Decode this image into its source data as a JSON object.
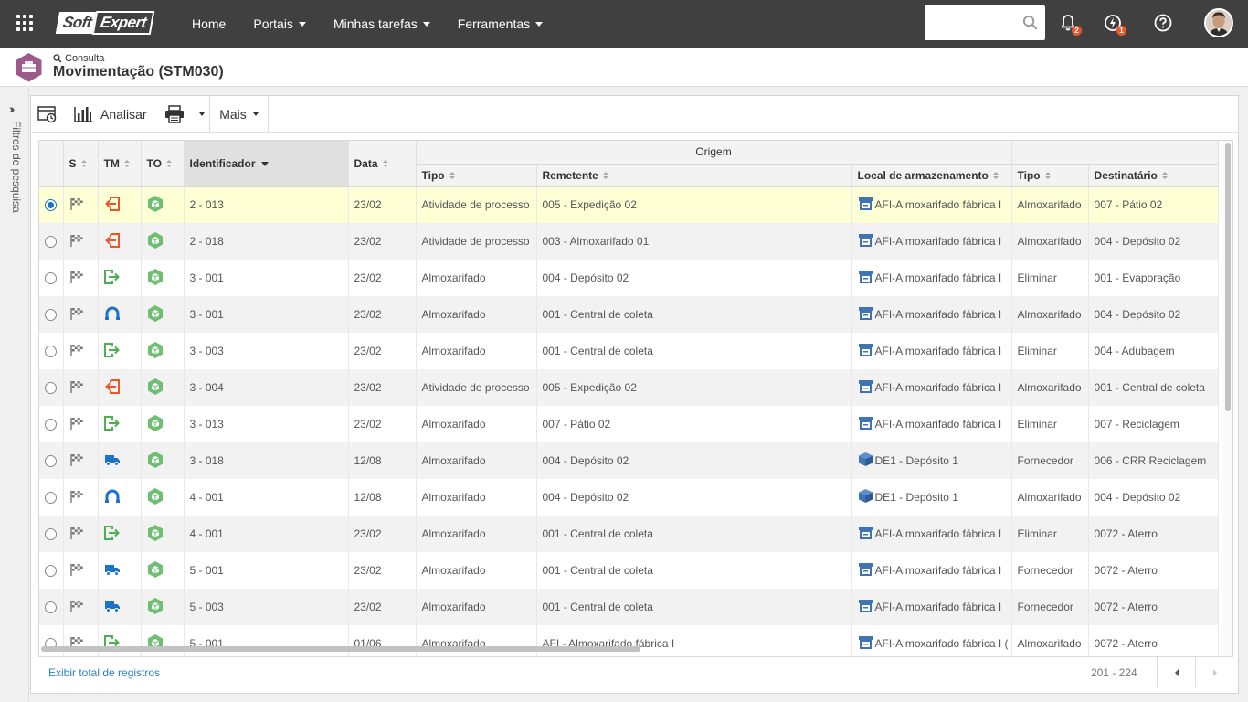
{
  "topbar": {
    "logo_soft": "Soft",
    "logo_expert": "Expert",
    "nav": [
      {
        "label": "Home",
        "caret": false
      },
      {
        "label": "Portais",
        "caret": true
      },
      {
        "label": "Minhas tarefas",
        "caret": true
      },
      {
        "label": "Ferramentas",
        "caret": true
      }
    ],
    "search_placeholder": "",
    "notifications_count": "2",
    "tasks_count": "1"
  },
  "header": {
    "breadcrumb": "Consulta",
    "title": "Movimentação (STM030)"
  },
  "filter_strip": {
    "label": "Filtros de pesquisa"
  },
  "toolbar": {
    "analyze_label": "Analisar",
    "more_label": "Mais"
  },
  "grid": {
    "group_header": "Origem",
    "columns": {
      "s": "S",
      "tm": "TM",
      "to": "TO",
      "id": "Identificador",
      "date": "Data",
      "orig_type": "Tipo",
      "sender": "Remetente",
      "storage": "Local de armazenamento",
      "dest_type": "Tipo",
      "recipient": "Destinatário"
    },
    "rows": [
      {
        "selected": true,
        "tm": "in-red",
        "id": "2 - 013",
        "date": "23/02",
        "orig_type": "Atividade de processo",
        "sender": "005 - Expedição 02",
        "storage_icon": "archive",
        "storage": "AFI-Almoxarifado fábrica I",
        "dest_type": "Almoxarifado",
        "recipient": "007 - Pátio 02"
      },
      {
        "selected": false,
        "tm": "in-red",
        "id": "2 - 018",
        "date": "23/02",
        "orig_type": "Atividade de processo",
        "sender": "003 - Almoxarifado 01",
        "storage_icon": "archive",
        "storage": "AFI-Almoxarifado fábrica I",
        "dest_type": "Almoxarifado",
        "recipient": "004 - Depósito 02"
      },
      {
        "selected": false,
        "tm": "out-green",
        "id": "3 - 001",
        "date": "23/02",
        "orig_type": "Almoxarifado",
        "sender": "004 - Depósito 02",
        "storage_icon": "archive",
        "storage": "AFI-Almoxarifado fábrica I",
        "dest_type": "Eliminar",
        "recipient": "001 - Evaporação"
      },
      {
        "selected": false,
        "tm": "magnet",
        "id": "3 - 001",
        "date": "23/02",
        "orig_type": "Almoxarifado",
        "sender": "001 - Central de coleta",
        "storage_icon": "archive",
        "storage": "AFI-Almoxarifado fábrica I",
        "dest_type": "Almoxarifado",
        "recipient": "004 - Depósito 02"
      },
      {
        "selected": false,
        "tm": "out-green",
        "id": "3 - 003",
        "date": "23/02",
        "orig_type": "Almoxarifado",
        "sender": "001 - Central de coleta",
        "storage_icon": "archive",
        "storage": "AFI-Almoxarifado fábrica I",
        "dest_type": "Eliminar",
        "recipient": "004 - Adubagem"
      },
      {
        "selected": false,
        "tm": "in-red",
        "id": "3 - 004",
        "date": "23/02",
        "orig_type": "Atividade de processo",
        "sender": "005 - Expedição 02",
        "storage_icon": "archive",
        "storage": "AFI-Almoxarifado fábrica I",
        "dest_type": "Almoxarifado",
        "recipient": "001 - Central de coleta"
      },
      {
        "selected": false,
        "tm": "out-green",
        "id": "3 - 013",
        "date": "23/02",
        "orig_type": "Almoxarifado",
        "sender": "007 - Pátio 02",
        "storage_icon": "archive",
        "storage": "AFI-Almoxarifado fábrica I",
        "dest_type": "Eliminar",
        "recipient": "007 - Reciclagem"
      },
      {
        "selected": false,
        "tm": "truck",
        "id": "3 - 018",
        "date": "12/08",
        "orig_type": "Almoxarifado",
        "sender": "004 - Depósito 02",
        "storage_icon": "box",
        "storage": "DE1 - Depósito 1",
        "dest_type": "Fornecedor",
        "recipient": "006 - CRR Reciclagem"
      },
      {
        "selected": false,
        "tm": "magnet",
        "id": "4 - 001",
        "date": "12/08",
        "orig_type": "Almoxarifado",
        "sender": "004 - Depósito 02",
        "storage_icon": "box",
        "storage": "DE1 - Depósito 1",
        "dest_type": "Almoxarifado",
        "recipient": "004 - Depósito 02"
      },
      {
        "selected": false,
        "tm": "out-green",
        "id": "4 - 001",
        "date": "23/02",
        "orig_type": "Almoxarifado",
        "sender": "001 - Central de coleta",
        "storage_icon": "archive",
        "storage": "AFI-Almoxarifado fábrica I",
        "dest_type": "Eliminar",
        "recipient": "0072 - Aterro"
      },
      {
        "selected": false,
        "tm": "truck",
        "id": "5 - 001",
        "date": "23/02",
        "orig_type": "Almoxarifado",
        "sender": "001 - Central de coleta",
        "storage_icon": "archive",
        "storage": "AFI-Almoxarifado fábrica I",
        "dest_type": "Fornecedor",
        "recipient": "0072 - Aterro"
      },
      {
        "selected": false,
        "tm": "truck",
        "id": "5 - 003",
        "date": "23/02",
        "orig_type": "Almoxarifado",
        "sender": "001 - Central de coleta",
        "storage_icon": "archive",
        "storage": "AFI-Almoxarifado fábrica I",
        "dest_type": "Fornecedor",
        "recipient": "0072 - Aterro"
      },
      {
        "selected": false,
        "tm": "out-green",
        "id": "5 - 001",
        "date": "01/06",
        "orig_type": "Almoxarifado",
        "sender": "AFI - Almoxarifado fábrica I",
        "storage_icon": "archive",
        "storage": "AFI-Almoxarifado fábrica I (",
        "dest_type": "Almoxarifado",
        "recipient": "0072 - Aterro"
      }
    ]
  },
  "footer": {
    "show_total_label": "Exibir total de registros",
    "range": "201 - 224"
  },
  "colors": {
    "topbar": "#404040",
    "selected_row": "#ffffd6",
    "link": "#2d7ec4",
    "badge": "#e8572a"
  }
}
